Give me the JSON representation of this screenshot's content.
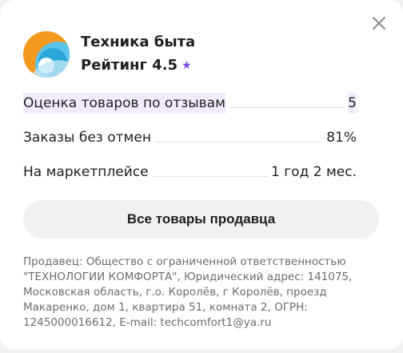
{
  "card": {
    "shop_name": "Техника быта",
    "rating_label": "Рейтинг 4.5",
    "rating_star": "★"
  },
  "stats": [
    {
      "label": "Оценка товаров по отзывам",
      "value": "5"
    },
    {
      "label": "Заказы без отмен",
      "value": "81%"
    },
    {
      "label": "На маркетплейсе",
      "value": "1 год 2 мес."
    }
  ],
  "button": {
    "label": "Все товары продавца"
  },
  "legal": {
    "line1": "Продавец: Общество с ограниченной ответственностью",
    "line2": "\"ТЕХНОЛОГИИ КОМФОРТА\", Юридический адрес: 141075,",
    "line3": "Московская область, г.о. Королёв, г Королёв, проезд",
    "line4": "Макаренко, дом 1, квартира 51, комната 2, ОГРН:",
    "line5": "1245000016612, E-mail: techcomfort1@ya.ru"
  },
  "icons": {
    "close": "close-icon",
    "logo": "seller-logo"
  },
  "colors": {
    "accent": "#7b45e8",
    "highlight": "#f1ebfd",
    "logo_orange": "#f39a1e",
    "logo_blue": "#2aa6d8"
  }
}
